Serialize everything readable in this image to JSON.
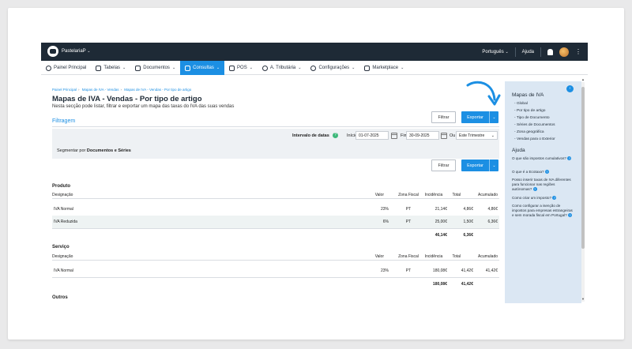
{
  "topbar": {
    "company": "PastelariaP",
    "language": "Português",
    "help": "Ajuda"
  },
  "nav": [
    {
      "label": "Painel Principal",
      "icon": "dashboard-icon"
    },
    {
      "label": "Tabelas",
      "icon": "book-icon"
    },
    {
      "label": "Documentos",
      "icon": "document-icon"
    },
    {
      "label": "Consultas",
      "icon": "chart-icon"
    },
    {
      "label": "POS",
      "icon": "tools-icon"
    },
    {
      "label": "A. Tributária",
      "icon": "tax-icon"
    },
    {
      "label": "Configurações",
      "icon": "gear-icon"
    },
    {
      "label": "Marketplace",
      "icon": "grid-icon"
    }
  ],
  "breadcrumb": [
    "Painel Principal",
    "Mapas de IVA - Vendas",
    "Mapas de IVA - Vendas - Por tipo de artigo"
  ],
  "page": {
    "title": "Mapas de IVA - Vendas - Por tipo de artigo",
    "description": "Nesta secção pode listar, filtrar e exportar um mapa das taxas do IVA das suas vendas",
    "filtragem": "Filtragem"
  },
  "buttons": {
    "filter": "Filtrar",
    "export": "Exportar"
  },
  "filters": {
    "interval_label": "Intervalo de datas",
    "start_label": "Início",
    "start_value": "01-07-2025",
    "end_label": "Fim",
    "end_value": "30-09-2025",
    "or_label": "Ou",
    "period_value": "Este Trimestre",
    "segment_prefix": "Segmentar por",
    "segment_value": "Documentos e Séries"
  },
  "columns": {
    "designacao": "Designação",
    "valor": "Valor",
    "zona": "Zona Fiscal",
    "incidencia": "Incidência",
    "total": "Total",
    "acumulado": "Acumulado"
  },
  "sections": [
    {
      "title": "Produto",
      "rows": [
        {
          "designacao": "IVA Normal",
          "valor": "23%",
          "zona": "PT",
          "incidencia": "21,14€",
          "total": "4,86€",
          "acumulado": "4,86€"
        },
        {
          "designacao": "IVA Reduzida",
          "valor": "6%",
          "zona": "PT",
          "incidencia": "25,00€",
          "total": "1,50€",
          "acumulado": "6,36€"
        }
      ],
      "totals": {
        "incidencia": "46,14€",
        "total": "6,36€"
      }
    },
    {
      "title": "Serviço",
      "rows": [
        {
          "designacao": "IVA Normal",
          "valor": "23%",
          "zona": "PT",
          "incidencia": "180,08€",
          "total": "41,42€",
          "acumulado": "41,42€"
        }
      ],
      "totals": {
        "incidencia": "180,08€",
        "total": "41,42€"
      }
    },
    {
      "title": "Outros"
    }
  ],
  "sidebar": {
    "title": "Mapas de IVA",
    "links": [
      "Global",
      "Por tipo de artigo",
      "Tipo de Documento",
      "Séries de Documentos",
      "Zona geográfica",
      "Vendas para o Exterior"
    ],
    "help_title": "Ajuda",
    "help_items": [
      "O que são impostos cumulativos?",
      "O que é a Ecotaxa?",
      "Posso inserir taxas de IVA diferentes para funcionar nas regiões autónomas?",
      "Como criar um imposto?",
      "Como configurar a isenção de impostos para empresas estrangeiras e sem morada fiscal em Portugal?"
    ]
  },
  "colors": {
    "accent": "#1c8fe3",
    "topbar": "#1e2a36",
    "sidebar": "#dbe7f3"
  }
}
